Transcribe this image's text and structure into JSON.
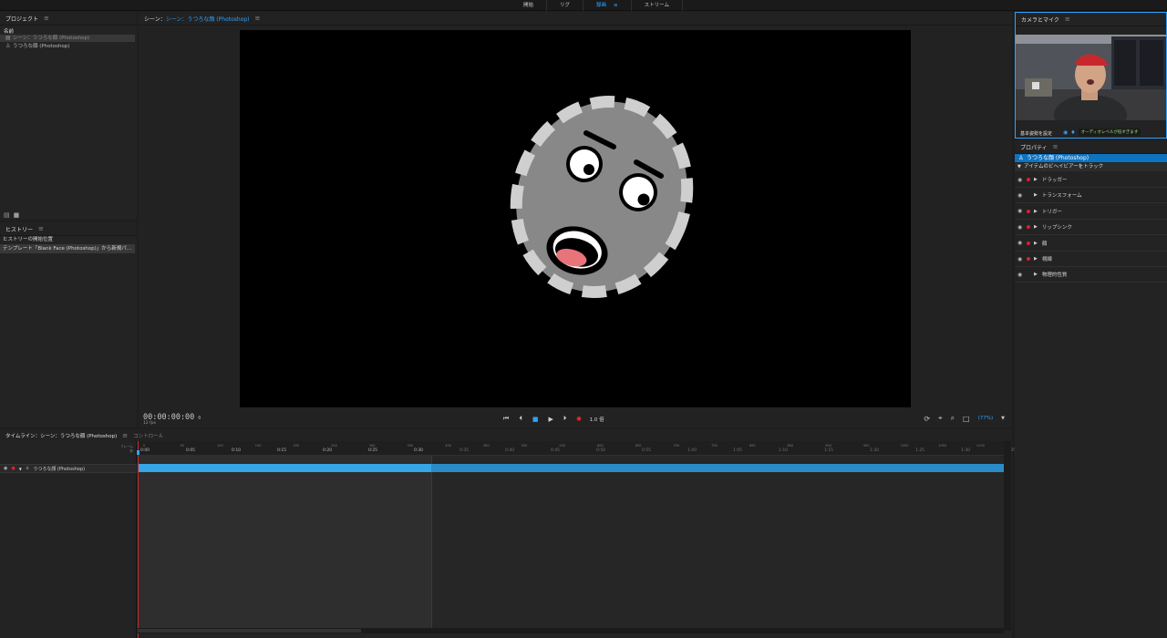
{
  "top_tabs": [
    {
      "label": "開始",
      "active": false
    },
    {
      "label": "リグ",
      "active": false
    },
    {
      "label": "録画",
      "active": true
    },
    {
      "label": "ストリーム",
      "active": false
    }
  ],
  "project": {
    "title": "プロジェクト",
    "column_name": "名前",
    "items": [
      {
        "label": "シーン：うつろな顔 (Photoshop)",
        "icon": "scene-icon",
        "selected": true
      },
      {
        "label": "うつろな顔 (Photoshop)",
        "icon": "puppet-icon",
        "selected": false
      }
    ]
  },
  "history": {
    "title": "ヒストリー",
    "items": [
      {
        "label": "ヒストリーの開始位置",
        "selected": false
      },
      {
        "label": "テンプレート「Blank Face (Photoshop)」から新規パ…",
        "selected": true
      }
    ]
  },
  "scene": {
    "title_prefix": "シーン：",
    "title_name": "シーン：うつろな顔 (Photoshop)",
    "timecode": "00:00:00:00",
    "timecode_sub": "0",
    "fps": "12 fps",
    "speed": "1.0 倍",
    "zoom": "(77%)"
  },
  "timeline": {
    "tab_active": "タイムライン：シーン：うつろな顔 (Photoshop)",
    "tab_inactive": "コントロール",
    "frame_label": "フレーム",
    "sec_label": "秒",
    "track_name": "うつろな顔 (Photoshop)",
    "major_ticks": [
      "0:00",
      "0:05",
      "0:10",
      "0:15",
      "0:20",
      "0:25",
      "0:30",
      "0:35",
      "0:40",
      "0:45",
      "0:50",
      "0:55",
      "1:00",
      "1:05",
      "1:10",
      "1:15",
      "1:20",
      "1:25",
      "1:30",
      "1:35"
    ],
    "minor_ticks": [
      "0",
      "50",
      "100",
      "150",
      "200",
      "250",
      "300",
      "350",
      "400",
      "450",
      "500",
      "550",
      "600",
      "650",
      "700",
      "750",
      "800",
      "850",
      "900",
      "950",
      "1000",
      "1050",
      "1100",
      "1150"
    ]
  },
  "camera": {
    "title": "カメラとマイク",
    "set_rest_pose": "基本姿勢を設定",
    "audio_level": "オーディオレベルが低すぎます"
  },
  "properties": {
    "title": "プロパティ",
    "puppet_name": "うつろな顔 (Photoshop)",
    "track_behaviors": "アイテムのビヘイビアーをトラック",
    "behaviors": [
      {
        "label": "ドラッガー",
        "armed": true
      },
      {
        "label": "トランスフォーム",
        "armed": false
      },
      {
        "label": "トリガー",
        "armed": true
      },
      {
        "label": "リップシンク",
        "armed": true
      },
      {
        "label": "顔",
        "armed": true
      },
      {
        "label": "視線",
        "armed": true
      },
      {
        "label": "物理的性質",
        "armed": false
      }
    ]
  },
  "colors": {
    "accent": "#2ea3ff",
    "selection": "#0f74c0",
    "record": "#d8222a",
    "track_bar": "#35a6e6"
  }
}
